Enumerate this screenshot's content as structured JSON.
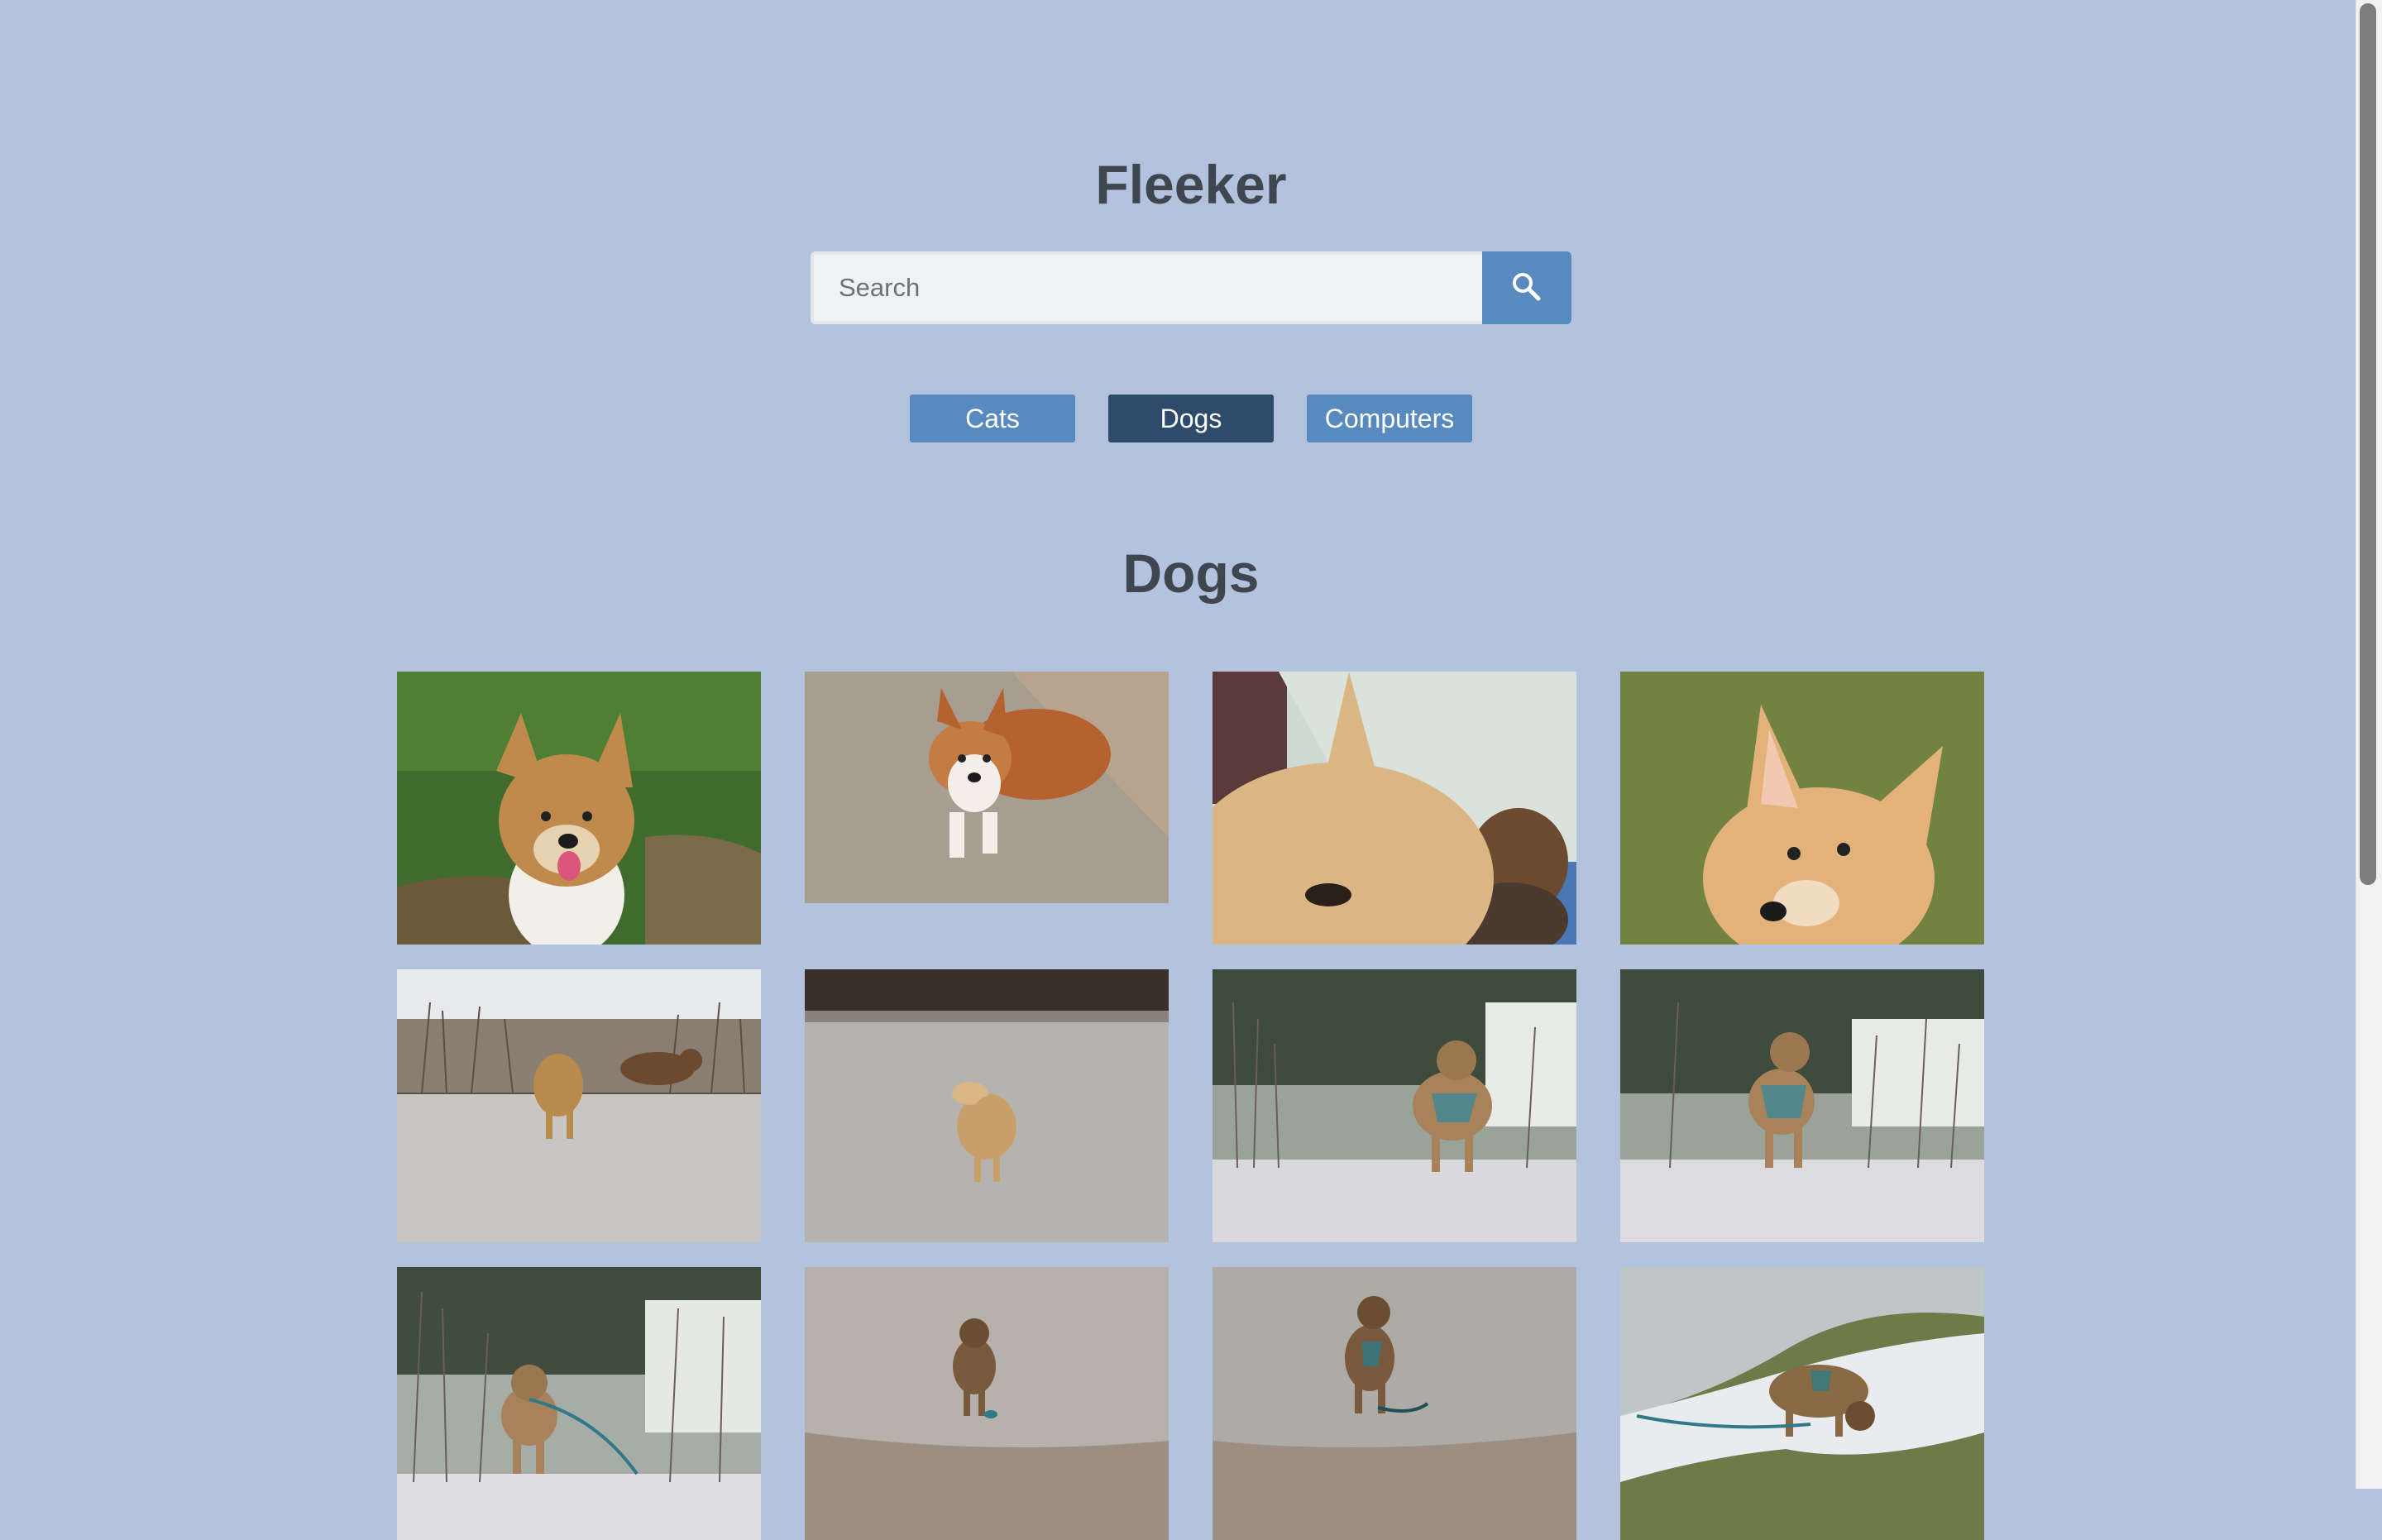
{
  "app": {
    "title": "Fleeker"
  },
  "search": {
    "placeholder": "Search",
    "button_icon": "search-icon"
  },
  "categories": [
    {
      "label": "Cats",
      "active": false
    },
    {
      "label": "Dogs",
      "active": true
    },
    {
      "label": "Computers",
      "active": false
    }
  ],
  "section": {
    "title": "Dogs"
  },
  "photos": [
    "corgi sitting on grass",
    "corgi lying on carpet",
    "close-up corgi with plush toy",
    "corgi face on grass",
    "golden dog running in snow with another dog",
    "golden dog walking on frosty field",
    "brown dog with harness by frosty bushes",
    "brown dog with harness by frosty bushes",
    "brown dog with leash near frosty brush",
    "brown dog trotting on frosty field",
    "brown dog running on frosty field",
    "brown dog sniffing snowy ground"
  ],
  "colors": {
    "background": "#b3c3de",
    "accent": "#588ac0",
    "active": "#2f4b6b",
    "heading": "#3f4650"
  }
}
